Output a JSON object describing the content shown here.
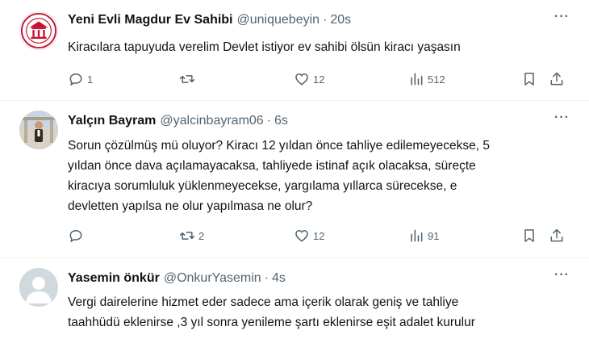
{
  "tweets": [
    {
      "name": "Yeni Evli Magdur Ev Sahibi",
      "handle": "@uniquebeyin",
      "separator": "·",
      "time": "20s",
      "more": "···",
      "text": "Kiracılara tapuyuda verelim Devlet istiyor ev sahibi ölsün kiracı yaşasın",
      "replies": "1",
      "retweets": "",
      "likes": "12",
      "views": "512"
    },
    {
      "name": "Yalçın Bayram",
      "handle": "@yalcinbayram06",
      "separator": "·",
      "time": "6s",
      "more": "···",
      "text": "Sorun çözülmüş mü oluyor? Kiracı 12 yıldan önce tahliye edilemeyecekse, 5\nyıldan önce dava açılamayacaksa, tahliyede istinaf açık olacaksa, süreçte\nkiracıya sorumluluk yüklenmeyecekse, yargılama yıllarca sürecekse, e\ndevletten yapılsa ne olur yapılmasa ne olur?",
      "replies": "",
      "retweets": "2",
      "likes": "12",
      "views": "91"
    },
    {
      "name": "Yasemin önkür",
      "handle": "@OnkurYasemin",
      "separator": "·",
      "time": "4s",
      "more": "···",
      "text": "Vergi dairelerine hizmet eder sadece ama içerik olarak geniş ve tahliye\ntaahhüdü eklenirse ,3 yıl sonra yenileme şartı eklenirse  eşit adalet kurulur"
    }
  ],
  "colors": {
    "text": "#0f1419",
    "muted": "#536471",
    "divider": "#eff3f4"
  },
  "icons": [
    "reply-icon",
    "retweet-icon",
    "like-icon",
    "views-icon",
    "bookmark-icon",
    "share-icon",
    "more-icon"
  ]
}
